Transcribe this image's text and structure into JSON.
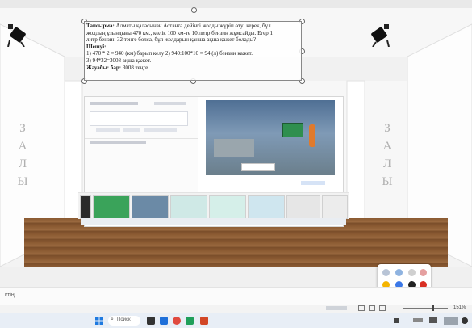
{
  "task": {
    "line1_label": "Тапсырма:",
    "line1_text": " Алматы қаласынан Астанға дейінгі жолды жүріп өтуі керек, бұл",
    "line2": "жолдың ұзындығы 470 км., көлік 100 км-те 10 литр бензин жұмсайды. Егер 1",
    "line3": "литр бензин 32 теңге болса, бұл жолдарын қанша ақша қажет болады?",
    "solution_label": "Шешуі:",
    "line5": "1) 470 * 2 = 940 (км) барып келу 2) 940:100*10 = 94 (л) бензин кажет.",
    "line6": "3) 94*32=3008 ақша қажет.",
    "answer_label": "Жауабы: бар:",
    "answer_value": " 3008 теңге"
  },
  "side_text": {
    "left": [
      "З",
      "А",
      "Л",
      "Ы"
    ],
    "right": [
      "З",
      "А",
      "Л",
      "Ы"
    ]
  },
  "notes": {
    "text": "ктің"
  },
  "status": {
    "zoom": "151%"
  },
  "taskbar": {
    "search_label": "Поиск"
  },
  "palette": {
    "colors": [
      "#f4b400",
      "#3b78e7",
      "#222222",
      "#d93025",
      "#f08a24",
      "#1a73e8"
    ]
  }
}
